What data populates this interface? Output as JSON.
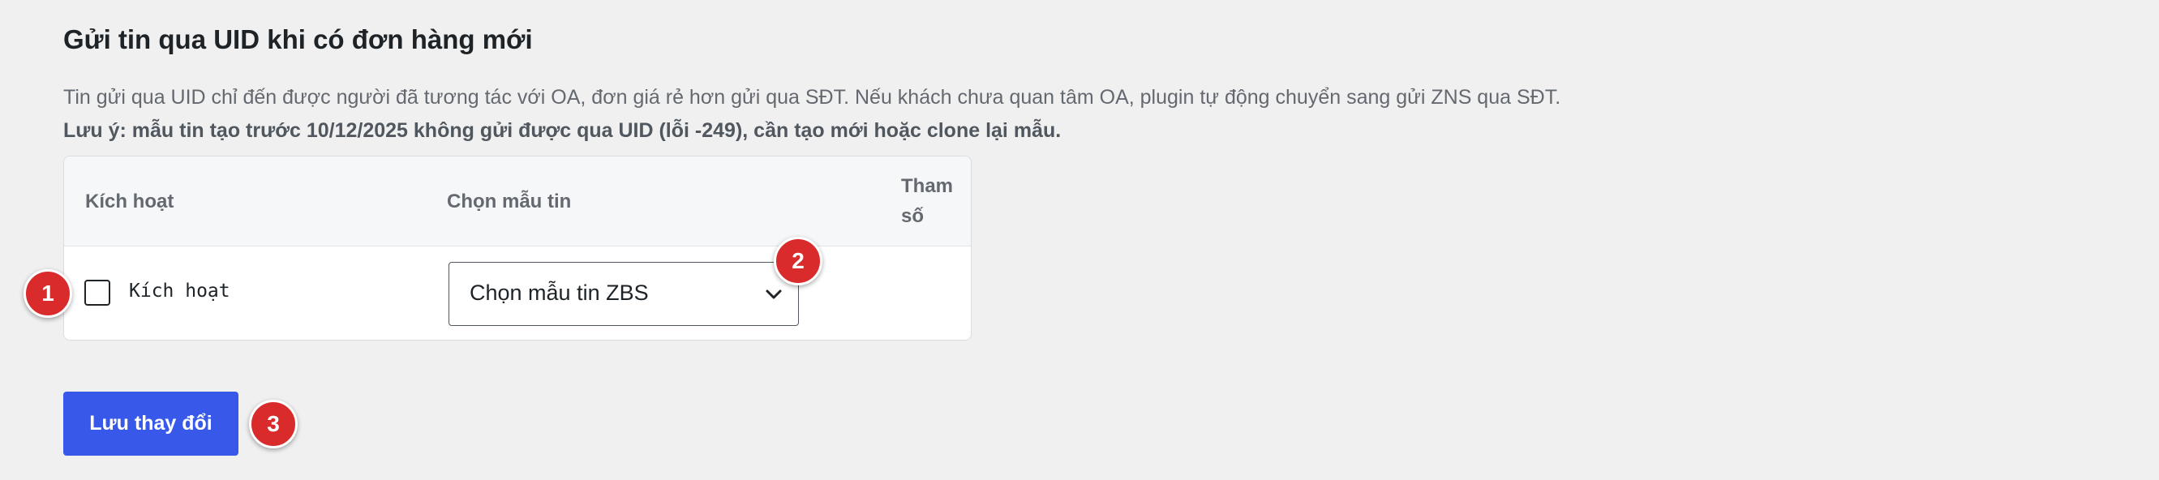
{
  "section": {
    "title": "Gửi tin qua UID khi có đơn hàng mới",
    "description": "Tin gửi qua UID chỉ đến được người đã tương tác với OA, đơn giá rẻ hơn gửi qua SĐT. Nếu khách chưa quan tâm OA, plugin tự động chuyển sang gửi ZNS qua SĐT.",
    "note": "Lưu ý: mẫu tin tạo trước 10/12/2025 không gửi được qua UID (lỗi -249), cần tạo mới hoặc clone lại mẫu."
  },
  "table": {
    "headers": {
      "activate": "Kích hoạt",
      "template": "Chọn mẫu tin",
      "params": "Tham số"
    },
    "row": {
      "checkbox_label": "Kích hoạt",
      "checkbox_checked": false,
      "select_value": "Chọn mẫu tin ZBS"
    }
  },
  "actions": {
    "save_label": "Lưu thay đổi"
  },
  "markers": [
    "1",
    "2",
    "3"
  ],
  "icons": {
    "select_chevron": "chevron-down-icon"
  },
  "colors": {
    "accent": "#3858e9",
    "marker": "#d92b2b",
    "background": "#f0f0f1"
  }
}
